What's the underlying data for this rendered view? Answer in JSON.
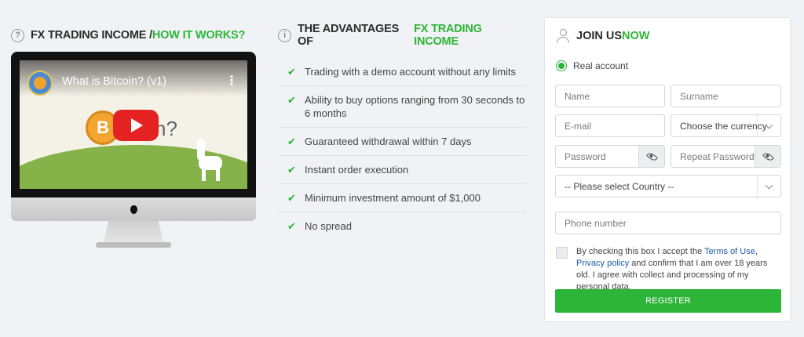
{
  "col1": {
    "title_part1": "FX TRADING INCOME / ",
    "title_part2": "HOW IT WORKS?",
    "title_icon": "question-circle-icon",
    "video": {
      "title": "What is Bitcoin? (v1)",
      "coin_glyph": "B",
      "question_text": "n?",
      "more_glyph": "⋮"
    }
  },
  "col2": {
    "title_part1": "THE ADVANTAGES OF ",
    "title_part2": "FX TRADING INCOME",
    "title_icon": "info-circle-icon",
    "check_glyph": "✔",
    "items": [
      "Trading with a demo account without any limits",
      "Ability to buy options ranging from 30 seconds to 6 months",
      "Guaranteed withdrawal within 7 days",
      "Instant order execution",
      "Minimum investment amount of $1,000",
      "No spread"
    ]
  },
  "form": {
    "title_part1": "JOIN US ",
    "title_part2": "NOW",
    "title_icon": "user-icon",
    "account_type": "Real account",
    "name_placeholder": "Name",
    "surname_placeholder": "Surname",
    "email_placeholder": "E-mail",
    "currency_selected": "Choose the currency",
    "password_placeholder": "Password",
    "repeat_password_placeholder": "Repeat Password",
    "country_selected": "-- Please select Country --",
    "phone_placeholder": "Phone number",
    "terms_prefix": "By checking this box I accept the ",
    "terms_link": "Terms of Use",
    "terms_sep": ", ",
    "privacy_link": "Privacy policy",
    "terms_suffix": " and confirm that I am over 18 years old. I agree with collect and processing of my personal data.",
    "register_label": "REGISTER"
  },
  "colors": {
    "accent": "#2db539",
    "link": "#1e5aa8",
    "background": "#f0f2f5"
  }
}
